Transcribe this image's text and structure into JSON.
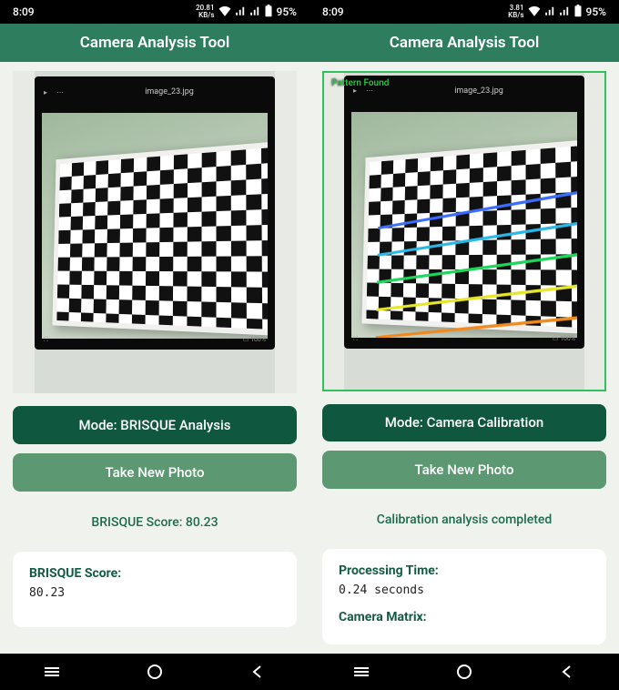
{
  "left": {
    "status": {
      "time": "8:09",
      "kbs": "20.81\nKB/s",
      "battery": "95%"
    },
    "header": "Camera Analysis Tool",
    "image_filename": "image_23.jpg",
    "mode_button": "Mode: BRISQUE Analysis",
    "photo_button": "Take New Photo",
    "status_text": "BRISQUE Score: 80.23",
    "card": {
      "label": "BRISQUE Score:",
      "value": "80.23"
    }
  },
  "right": {
    "status": {
      "time": "8:09",
      "kbs": "3.81\nKB/s",
      "battery": "95%"
    },
    "header": "Camera Analysis Tool",
    "pattern_label": "Pattern Found",
    "image_filename": "image_23.jpg",
    "mode_button": "Mode: Camera Calibration",
    "photo_button": "Take New Photo",
    "status_text": "Calibration analysis completed",
    "card": {
      "label1": "Processing Time:",
      "value1": "0.24 seconds",
      "label2": "Camera Matrix:"
    }
  }
}
